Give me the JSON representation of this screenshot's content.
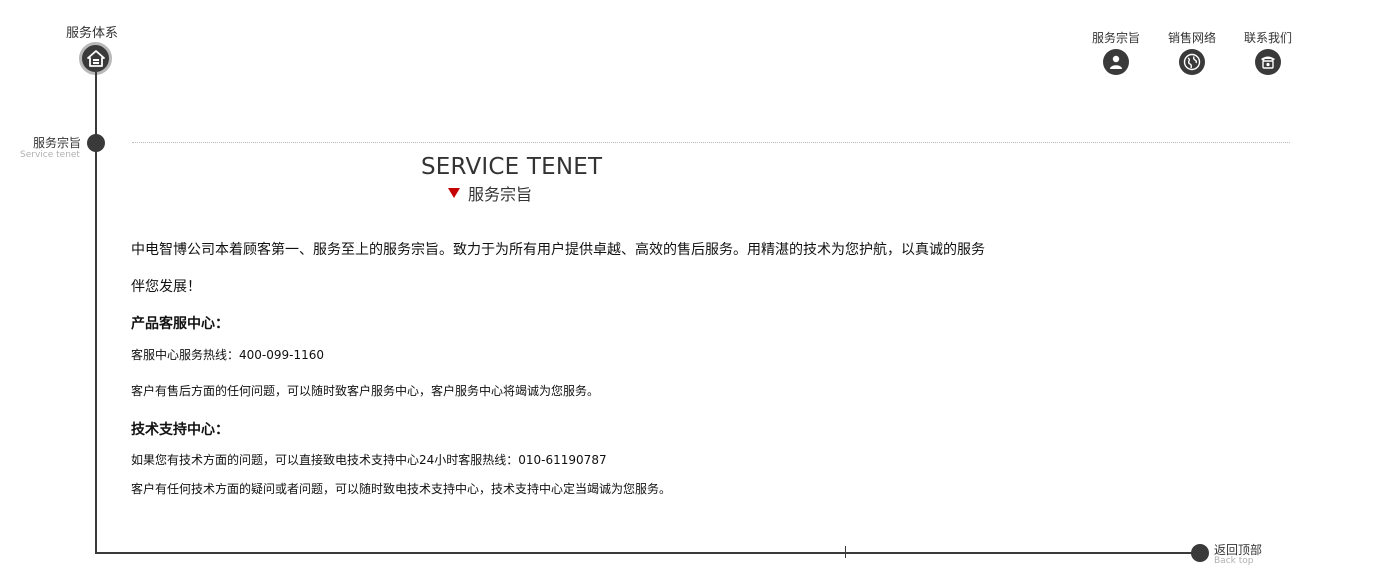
{
  "section": {
    "title": "服务体系",
    "home_icon": "home-icon"
  },
  "top_nav": [
    {
      "label": "服务宗旨",
      "icon": "user-icon"
    },
    {
      "label": "销售网络",
      "icon": "globe-icon"
    },
    {
      "label": "联系我们",
      "icon": "phone-icon"
    }
  ],
  "timeline": {
    "tenet_label": "服务宗旨",
    "tenet_sub": "Service tenet",
    "back_top_label": "返回顶部",
    "back_top_sub": "Back top"
  },
  "heading": {
    "en": "SERVICE TENET",
    "cn": "服务宗旨",
    "accent_color": "#c40000"
  },
  "content": {
    "intro": "中电智博公司本着顾客第一、服务至上的服务宗旨。致力于为所有用户提供卓越、高效的售后服务。用精湛的技术为您护航，以真诚的服务伴您发展！",
    "customer_center_title": "产品客服中心：",
    "customer_hotline": "客服中心服务热线：400-099-1160",
    "customer_desc": "客户有售后方面的任何问题，可以随时致客户服务中心，客户服务中心将竭诚为您服务。",
    "tech_center_title": "技术支持中心：",
    "tech_hotline": "如果您有技术方面的问题，可以直接致电技术支持中心24小时客服热线：010-61190787",
    "tech_desc": "客户有任何技术方面的疑问或者问题，可以随时致电技术支持中心，技术支持中心定当竭诚为您服务。"
  }
}
